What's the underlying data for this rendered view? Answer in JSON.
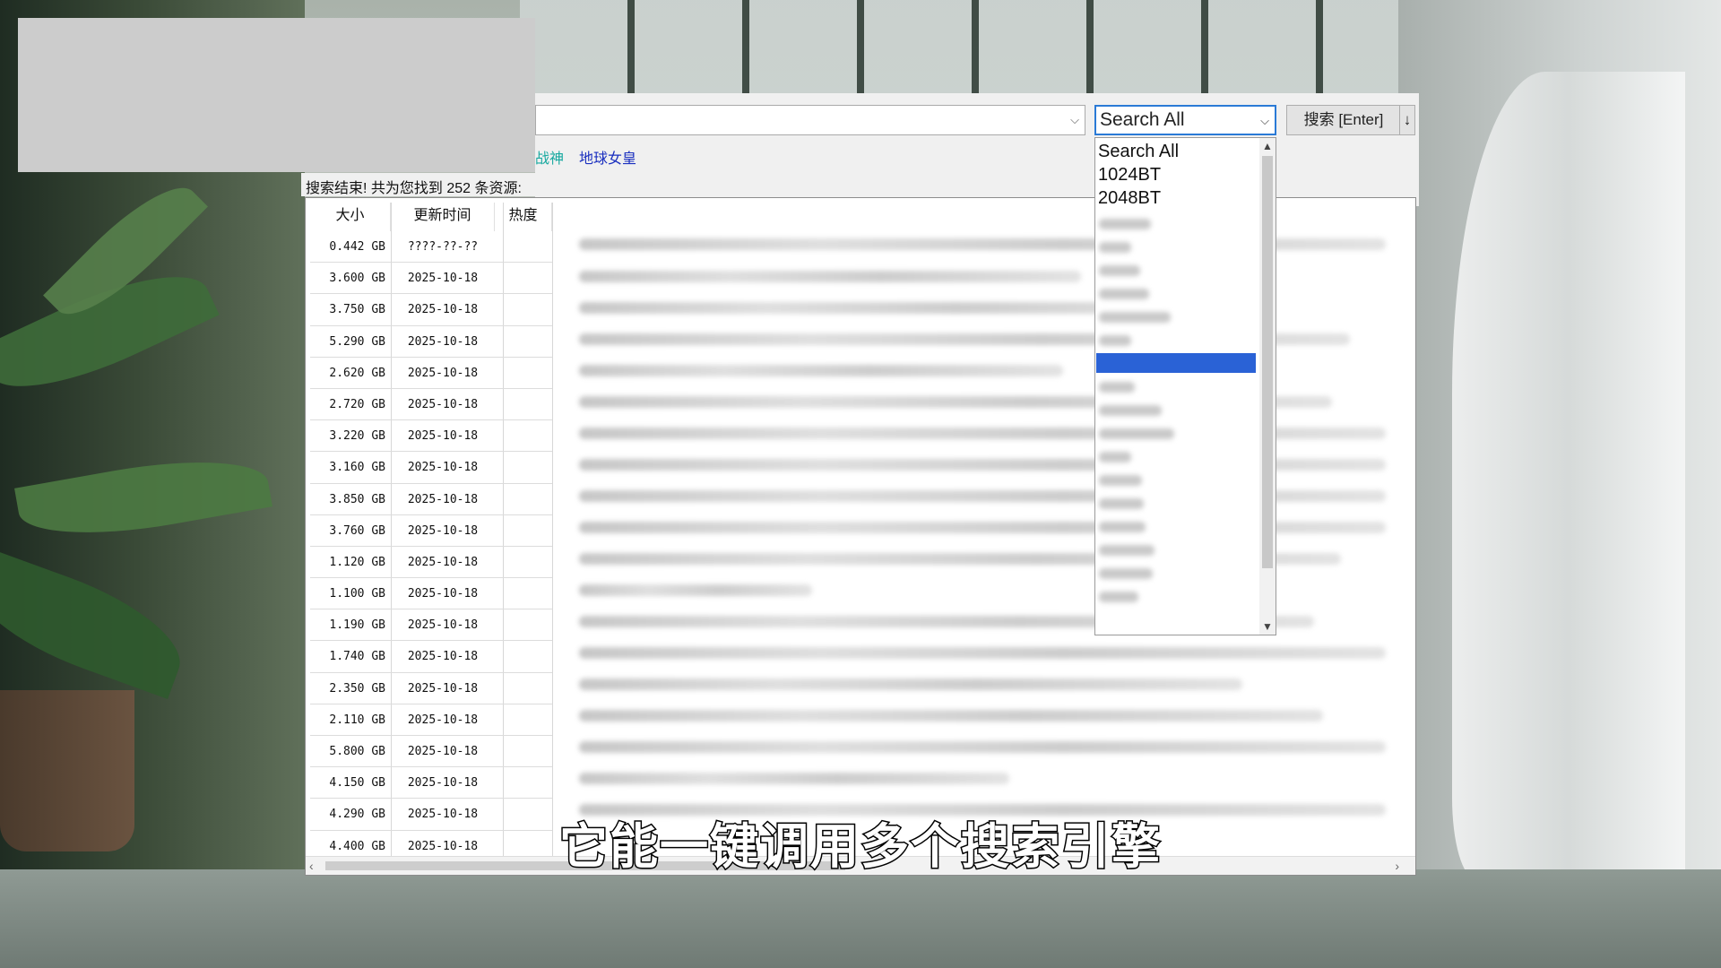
{
  "search": {
    "input_value": "",
    "engine_selected": "Search All",
    "search_button_label": "搜索 [Enter]",
    "sort_button_label": "↓"
  },
  "tags": [
    {
      "label": "战神",
      "color": "#18a9a0"
    },
    {
      "label": "地球女皇",
      "color": "#1a2fbf"
    }
  ],
  "summary": "搜索结束! 共为您找到 252 条资源:",
  "table": {
    "headers": [
      "大小",
      "更新时间",
      "热度"
    ],
    "rows": [
      {
        "size": "0.442 GB",
        "date": "????-??-??"
      },
      {
        "size": "3.600 GB",
        "date": "2025-10-18"
      },
      {
        "size": "3.750 GB",
        "date": "2025-10-18"
      },
      {
        "size": "5.290 GB",
        "date": "2025-10-18"
      },
      {
        "size": "2.620 GB",
        "date": "2025-10-18"
      },
      {
        "size": "2.720 GB",
        "date": "2025-10-18"
      },
      {
        "size": "3.220 GB",
        "date": "2025-10-18"
      },
      {
        "size": "3.160 GB",
        "date": "2025-10-18"
      },
      {
        "size": "3.850 GB",
        "date": "2025-10-18"
      },
      {
        "size": "3.760 GB",
        "date": "2025-10-18"
      },
      {
        "size": "1.120 GB",
        "date": "2025-10-18"
      },
      {
        "size": "1.100 GB",
        "date": "2025-10-18"
      },
      {
        "size": "1.190 GB",
        "date": "2025-10-18"
      },
      {
        "size": "1.740 GB",
        "date": "2025-10-18"
      },
      {
        "size": "2.350 GB",
        "date": "2025-10-18"
      },
      {
        "size": "2.110 GB",
        "date": "2025-10-18"
      },
      {
        "size": "5.800 GB",
        "date": "2025-10-18"
      },
      {
        "size": "4.150 GB",
        "date": "2025-10-18"
      },
      {
        "size": "4.290 GB",
        "date": "2025-10-18"
      },
      {
        "size": "4.400 GB",
        "date": "2025-10-18"
      }
    ]
  },
  "dropdown": {
    "options": [
      "Search All",
      "1024BT",
      "2048BT"
    ]
  },
  "subtitle": "它能一键调用多个搜索引擎",
  "colors": {
    "accent": "#2a7ad6",
    "selection": "#2a62d6"
  },
  "icons": {
    "combo_caret": "chevron-down-icon",
    "scroll_left": "arrow-left-icon",
    "scroll_right": "arrow-right-icon"
  }
}
